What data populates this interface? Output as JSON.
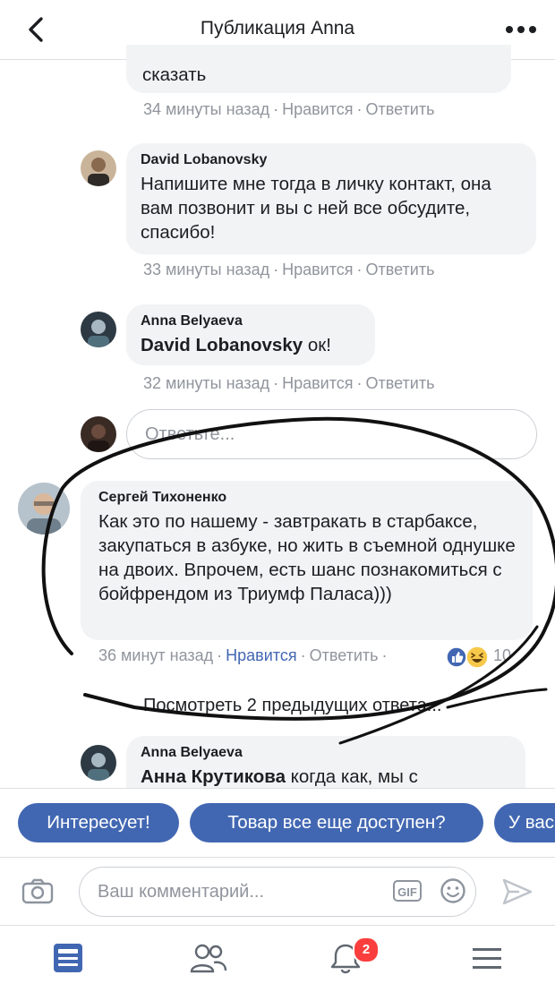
{
  "header": {
    "title": "Публикация Anna"
  },
  "comments": [
    {
      "author": "",
      "text": "сказать",
      "time": "34 минуты назад",
      "like": "Нравится",
      "reply": "Ответить"
    },
    {
      "author": "David Lobanovsky",
      "text": "Напишите мне тогда в личку контакт, она вам позвонит и вы с ней все обсудите, спасибо!",
      "time": "33 минуты назад",
      "like": "Нравится",
      "reply": "Ответить"
    },
    {
      "author": "Anna Belyaeva",
      "mention": "David Lobanovsky",
      "text": " ок!",
      "time": "32 минуты назад",
      "like": "Нравится",
      "reply": "Ответить"
    },
    {
      "author": "Сергей Тихоненко",
      "text": "Как это по нашему - завтракать в старбаксе, закупаться в азбуке, но жить в съемной  однушке на двоих. Впрочем, есть шанс  познакомиться с бойфрендом из Триумф Паласа)))",
      "time": "36 минут назад",
      "like": "Нравится",
      "reply": "Ответить",
      "reactions_count": "10"
    },
    {
      "author": "Anna Belyaeva",
      "mention": "Анна Крутикова",
      "text": " когда как, мы с"
    }
  ],
  "reply_box": {
    "placeholder": "Ответьте..."
  },
  "view_more": "Посмотреть 2 предыдущих ответа...",
  "quick_replies": [
    "Интересует!",
    "Товар все еще доступен?",
    "У вас"
  ],
  "composer": {
    "placeholder": "Ваш комментарий...",
    "gif_label": "GIF"
  },
  "tabbar": {
    "notifications_badge": "2"
  },
  "colors": {
    "accent": "#4267b2",
    "bubble": "#f2f3f5",
    "badge": "#fa3e3e"
  }
}
